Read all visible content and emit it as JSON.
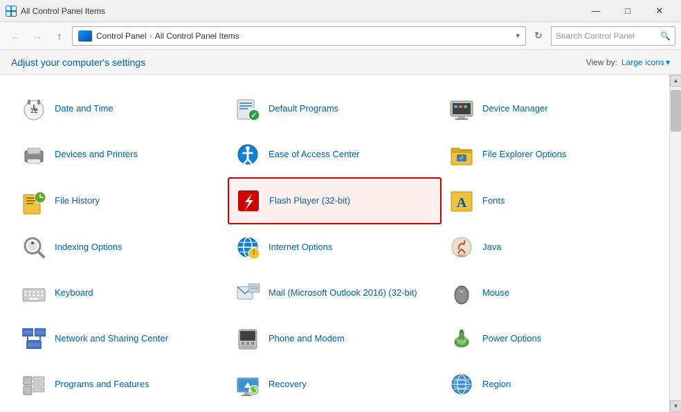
{
  "titleBar": {
    "title": "All Control Panel Items",
    "minimize": "—",
    "maximize": "□",
    "close": "✕"
  },
  "addressBar": {
    "breadcrumb1": "Control Panel",
    "breadcrumb2": "All Control Panel Items",
    "searchPlaceholder": "Search Control Panel",
    "refreshTitle": "Refresh"
  },
  "toolbar": {
    "heading": "Adjust your computer's settings",
    "viewByLabel": "View by:",
    "viewByValue": "Large icons",
    "viewByArrow": "▾"
  },
  "items": [
    {
      "id": "date-time",
      "label": "Date and Time",
      "icon": "clock",
      "selected": false
    },
    {
      "id": "default-programs",
      "label": "Default Programs",
      "icon": "default-prog",
      "selected": false
    },
    {
      "id": "device-manager",
      "label": "Device Manager",
      "icon": "device-mgr",
      "selected": false
    },
    {
      "id": "devices-printers",
      "label": "Devices and Printers",
      "icon": "printer",
      "selected": false
    },
    {
      "id": "ease-of-access",
      "label": "Ease of Access Center",
      "icon": "ease",
      "selected": false
    },
    {
      "id": "file-explorer",
      "label": "File Explorer Options",
      "icon": "folder",
      "selected": false
    },
    {
      "id": "file-history",
      "label": "File History",
      "icon": "file-history",
      "selected": false
    },
    {
      "id": "flash-player",
      "label": "Flash Player (32-bit)",
      "icon": "flash",
      "selected": true
    },
    {
      "id": "fonts",
      "label": "Fonts",
      "icon": "fonts",
      "selected": false
    },
    {
      "id": "indexing",
      "label": "Indexing Options",
      "icon": "indexing",
      "selected": false
    },
    {
      "id": "internet-options",
      "label": "Internet Options",
      "icon": "internet",
      "selected": false
    },
    {
      "id": "java",
      "label": "Java",
      "icon": "java",
      "selected": false
    },
    {
      "id": "keyboard",
      "label": "Keyboard",
      "icon": "keyboard",
      "selected": false
    },
    {
      "id": "mail",
      "label": "Mail (Microsoft Outlook 2016) (32-bit)",
      "icon": "mail",
      "selected": false
    },
    {
      "id": "mouse",
      "label": "Mouse",
      "icon": "mouse",
      "selected": false
    },
    {
      "id": "network",
      "label": "Network and Sharing Center",
      "icon": "network",
      "selected": false
    },
    {
      "id": "phone-modem",
      "label": "Phone and Modem",
      "icon": "phone",
      "selected": false
    },
    {
      "id": "power",
      "label": "Power Options",
      "icon": "power",
      "selected": false
    },
    {
      "id": "programs-features",
      "label": "Programs and Features",
      "icon": "programs",
      "selected": false
    },
    {
      "id": "recovery",
      "label": "Recovery",
      "icon": "recovery",
      "selected": false
    },
    {
      "id": "region",
      "label": "Region",
      "icon": "region",
      "selected": false
    }
  ]
}
